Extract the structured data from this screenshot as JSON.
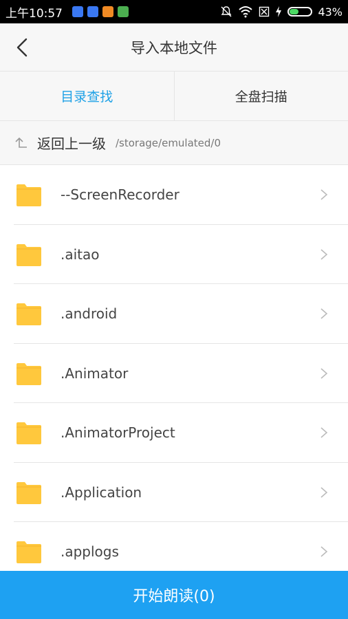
{
  "status_bar": {
    "time": "上午10:57",
    "battery_percent": "43%",
    "battery_level": 0.43,
    "notification_icons": [
      {
        "name": "shield-icon",
        "color": "#3a78f2"
      },
      {
        "name": "app-icon",
        "color": "#3a78f2"
      },
      {
        "name": "app-icon-orange",
        "color": "#f08a24"
      },
      {
        "name": "app-icon-green",
        "color": "#4caf50"
      }
    ]
  },
  "header": {
    "title": "导入本地文件"
  },
  "tabs": [
    {
      "label": "目录查找",
      "active": true
    },
    {
      "label": "全盘扫描",
      "active": false
    }
  ],
  "breadcrumb": {
    "back_label": "返回上一级",
    "path": "/storage/emulated/0"
  },
  "files": [
    {
      "name": "--ScreenRecorder"
    },
    {
      "name": ".aitao"
    },
    {
      "name": ".android"
    },
    {
      "name": ".Animator"
    },
    {
      "name": ".AnimatorProject"
    },
    {
      "name": ".Application"
    },
    {
      "name": ".applogs"
    }
  ],
  "bottom_button": {
    "label": "开始朗读(0)"
  },
  "colors": {
    "accent": "#1ea1e6",
    "button_bg": "#1ea1f2",
    "folder": "#ffc83d"
  }
}
